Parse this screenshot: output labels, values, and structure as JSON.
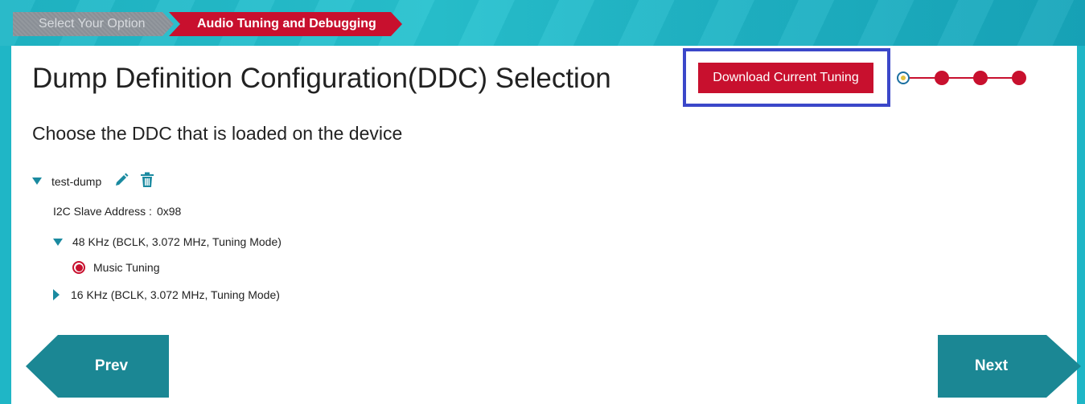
{
  "breadcrumb": {
    "step1": "Select Your Option",
    "step2": "Audio Tuning and Debugging"
  },
  "page": {
    "title": "Dump Definition Configuration(DDC) Selection",
    "subtitle": "Choose the DDC that is loaded on the device"
  },
  "actions": {
    "download_label": "Download Current Tuning"
  },
  "stepper": {
    "total_steps": 4,
    "current_step": 1
  },
  "ddc_tree": {
    "name": "test-dump",
    "i2c_label": "I2C Slave Address :",
    "i2c_value": "0x98",
    "modes": [
      {
        "label": "48 KHz  (BCLK, 3.072 MHz, Tuning Mode)",
        "expanded": true,
        "children": [
          {
            "label": "Music Tuning",
            "selected": true
          }
        ]
      },
      {
        "label": "16 KHz  (BCLK, 3.072 MHz, Tuning Mode)",
        "expanded": false
      }
    ]
  },
  "navigation": {
    "prev_label": "Prev",
    "next_label": "Next"
  },
  "colors": {
    "accent_red": "#c8102e",
    "teal": "#1fb6c6",
    "nav_teal": "#1b8794",
    "highlight_blue": "#3b47c9"
  },
  "icons": {
    "edit": "pencil-icon",
    "delete": "trash-icon"
  }
}
